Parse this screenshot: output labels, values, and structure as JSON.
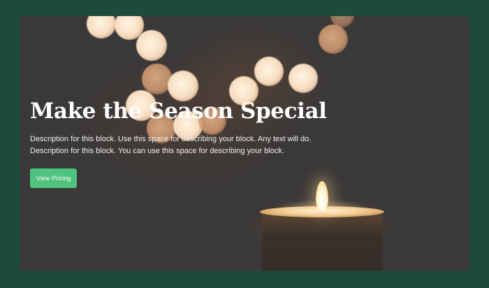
{
  "hero": {
    "title": "Make the Season Special",
    "description_lines": [
      "Description for this block. Use this space for describing your block. Any text will do.",
      "Description for this block. You can use this space for describing your block."
    ],
    "cta_label": "View Pricing"
  },
  "colors": {
    "page_background": "#1c4a3c",
    "hero_background": "#3a3838",
    "button": "#4fc27e",
    "text": "#ffffff"
  }
}
